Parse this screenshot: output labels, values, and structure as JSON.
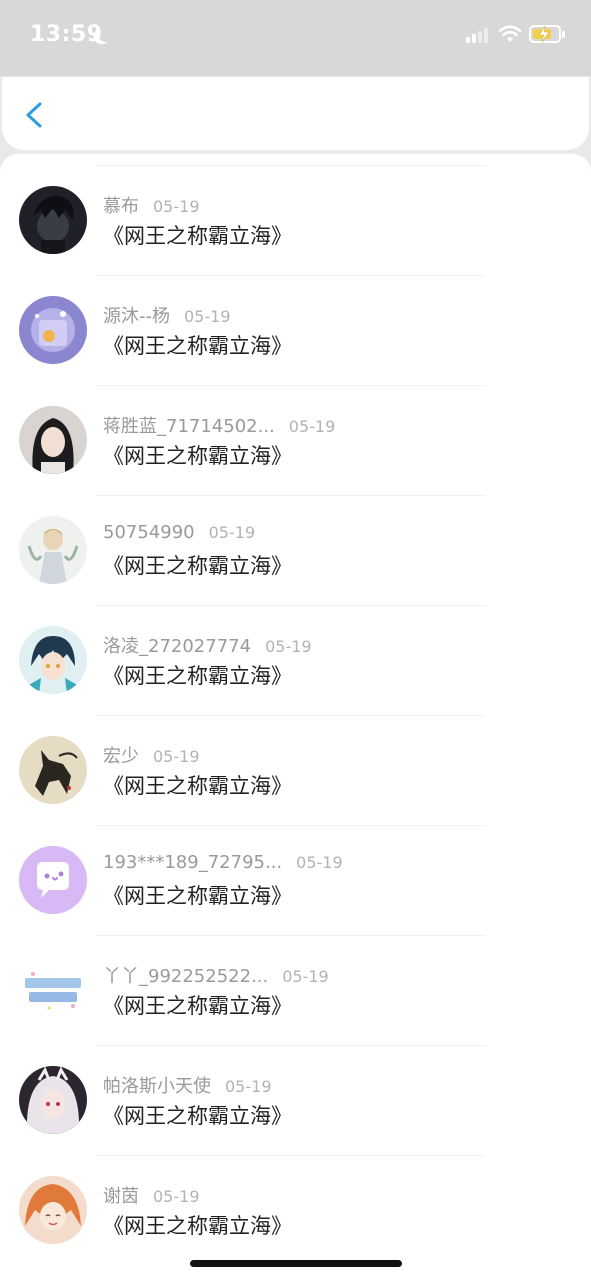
{
  "status_bar": {
    "time": "13:59",
    "icons": [
      "moon-icon",
      "cellular-signal-icon",
      "wifi-icon",
      "battery-charging-icon"
    ]
  },
  "header": {
    "back_icon": "chevron-left-icon",
    "accent_color": "#2d9be0"
  },
  "comments": [
    {
      "user": "慕布",
      "date": "05-19",
      "text": "《网王之称霸立海》",
      "avatar": "dark-haired-boy-avatar"
    },
    {
      "user": "源沐--杨",
      "date": "05-19",
      "text": "《网王之称霸立海》",
      "avatar": "purple-fantasy-avatar"
    },
    {
      "user": "蒋胜蓝_71714502...",
      "date": "05-19",
      "text": "《网王之称霸立海》",
      "avatar": "girl-photo-avatar"
    },
    {
      "user": "50754990",
      "date": "05-19",
      "text": "《网王之称霸立海》",
      "avatar": "anime-prince-avatar"
    },
    {
      "user": "洛凌_272027774",
      "date": "05-19",
      "text": "《网王之称霸立海》",
      "avatar": "anime-boy-teal-avatar"
    },
    {
      "user": "宏少",
      "date": "05-19",
      "text": "《网王之称霸立海》",
      "avatar": "ink-horse-avatar"
    },
    {
      "user": "193***189_72795...",
      "date": "05-19",
      "text": "《网王之称霸立海》",
      "avatar": "default-chat-bubble-avatar"
    },
    {
      "user": "丫丫_992252522...",
      "date": "05-19",
      "text": "《网王之称霸立海》",
      "avatar": "text-sticker-avatar"
    },
    {
      "user": " 帕洛斯小天使",
      "date": "05-19",
      "text": "《网王之称霸立海》",
      "avatar": "white-haired-anime-avatar"
    },
    {
      "user": "谢茵",
      "date": "05-19",
      "text": "《网王之称霸立海》",
      "avatar": "orange-haired-anime-avatar"
    }
  ],
  "colors": {
    "name_gray": "#9a9a9a",
    "date_gray": "#b3b3b3",
    "text_dark": "#222222",
    "status_bg": "#d8d8d8",
    "page_bg": "#ffffff"
  }
}
